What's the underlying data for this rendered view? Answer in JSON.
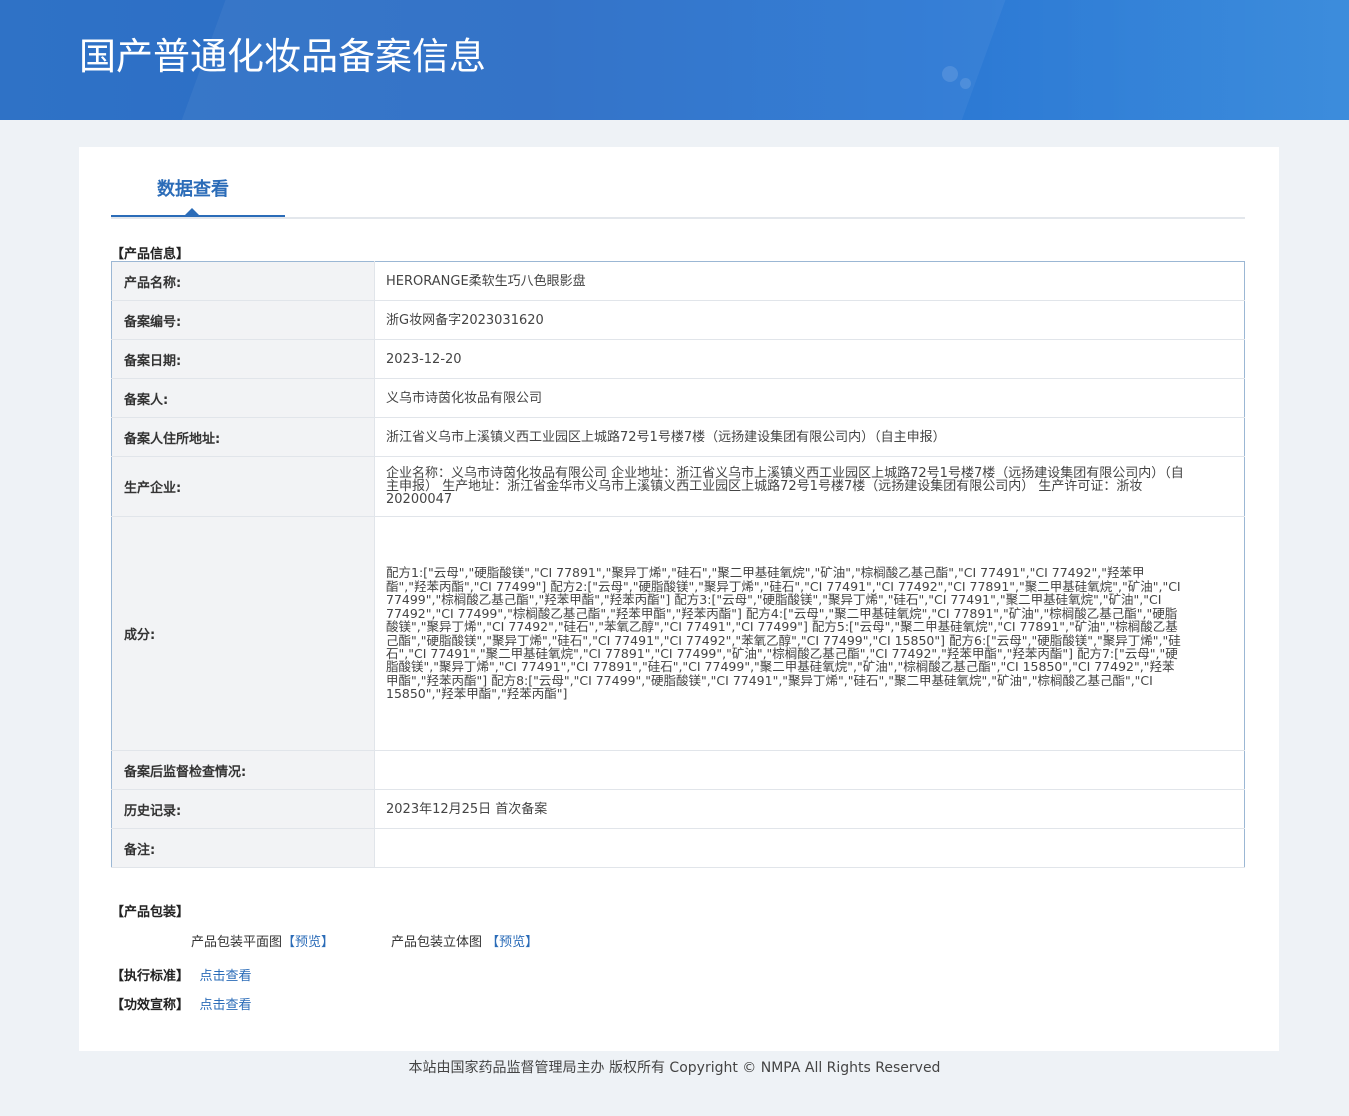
{
  "header": {
    "title": "国产普通化妆品备案信息"
  },
  "tab": {
    "label": "数据查看"
  },
  "product_info": {
    "section_title": "【产品信息】",
    "rows": [
      {
        "key": "产品名称:",
        "value": "HERORANGE柔软生巧八色眼影盘"
      },
      {
        "key": "备案编号:",
        "value": "浙G妆网备字2023031620"
      },
      {
        "key": "备案日期:",
        "value": "2023-12-20"
      },
      {
        "key": "备案人:",
        "value": "义乌市诗茵化妆品有限公司"
      },
      {
        "key": "备案人住所地址:",
        "value": "浙江省义乌市上溪镇义西工业园区上城路72号1号楼7楼（远扬建设集团有限公司内）（自主申报）"
      },
      {
        "key": "生产企业:",
        "value": "企业名称：义乌市诗茵化妆品有限公司 企业地址：浙江省义乌市上溪镇义西工业园区上城路72号1号楼7楼（远扬建设集团有限公司内）（自主申报） 生产地址：浙江省金华市义乌市上溪镇义西工业园区上城路72号1号楼7楼（远扬建设集团有限公司内） 生产许可证：浙妆20200047"
      },
      {
        "key": "成分:",
        "value": "配方1:[\"云母\",\"硬脂酸镁\",\"CI 77891\",\"聚异丁烯\",\"硅石\",\"聚二甲基硅氧烷\",\"矿油\",\"棕榈酸乙基己酯\",\"CI 77491\",\"CI 77492\",\"羟苯甲酯\",\"羟苯丙酯\",\"CI 77499\"] 配方2:[\"云母\",\"硬脂酸镁\",\"聚异丁烯\",\"硅石\",\"CI 77491\",\"CI 77492\",\"CI 77891\",\"聚二甲基硅氧烷\",\"矿油\",\"CI 77499\",\"棕榈酸乙基己酯\",\"羟苯甲酯\",\"羟苯丙酯\"] 配方3:[\"云母\",\"硬脂酸镁\",\"聚异丁烯\",\"硅石\",\"CI 77491\",\"聚二甲基硅氧烷\",\"矿油\",\"CI 77492\",\"CI 77499\",\"棕榈酸乙基己酯\",\"羟苯甲酯\",\"羟苯丙酯\"] 配方4:[\"云母\",\"聚二甲基硅氧烷\",\"CI 77891\",\"矿油\",\"棕榈酸乙基己酯\",\"硬脂酸镁\",\"聚异丁烯\",\"CI 77492\",\"硅石\",\"苯氧乙醇\",\"CI 77491\",\"CI 77499\"] 配方5:[\"云母\",\"聚二甲基硅氧烷\",\"CI 77891\",\"矿油\",\"棕榈酸乙基己酯\",\"硬脂酸镁\",\"聚异丁烯\",\"硅石\",\"CI 77491\",\"CI 77492\",\"苯氧乙醇\",\"CI 77499\",\"CI 15850\"] 配方6:[\"云母\",\"硬脂酸镁\",\"聚异丁烯\",\"硅石\",\"CI 77491\",\"聚二甲基硅氧烷\",\"CI 77891\",\"CI 77499\",\"矿油\",\"棕榈酸乙基己酯\",\"CI 77492\",\"羟苯甲酯\",\"羟苯丙酯\"] 配方7:[\"云母\",\"硬脂酸镁\",\"聚异丁烯\",\"CI 77491\",\"CI 77891\",\"硅石\",\"CI 77499\",\"聚二甲基硅氧烷\",\"矿油\",\"棕榈酸乙基己酯\",\"CI 15850\",\"CI 77492\",\"羟苯甲酯\",\"羟苯丙酯\"] 配方8:[\"云母\",\"CI 77499\",\"硬脂酸镁\",\"CI 77491\",\"聚异丁烯\",\"硅石\",\"聚二甲基硅氧烷\",\"矿油\",\"棕榈酸乙基己酯\",\"CI 15850\",\"羟苯甲酯\",\"羟苯丙酯\"]"
      },
      {
        "key": "备案后监督检查情况:",
        "value": ""
      },
      {
        "key": "历史记录:",
        "value": "2023年12月25日 首次备案"
      },
      {
        "key": "备注:",
        "value": ""
      }
    ]
  },
  "packaging": {
    "section_title": "【产品包装】",
    "flat_label": "产品包装平面图",
    "flat_link": "【预览】",
    "stereo_label": "产品包装立体图",
    "stereo_link": "【预览】"
  },
  "standard": {
    "label": "【执行标准】",
    "link": "点击查看"
  },
  "efficacy": {
    "label": "【功效宣称】",
    "link": "点击查看"
  },
  "footer": {
    "text": "本站由国家药品监督管理局主办 版权所有 Copyright © NMPA All Rights Reserved"
  }
}
